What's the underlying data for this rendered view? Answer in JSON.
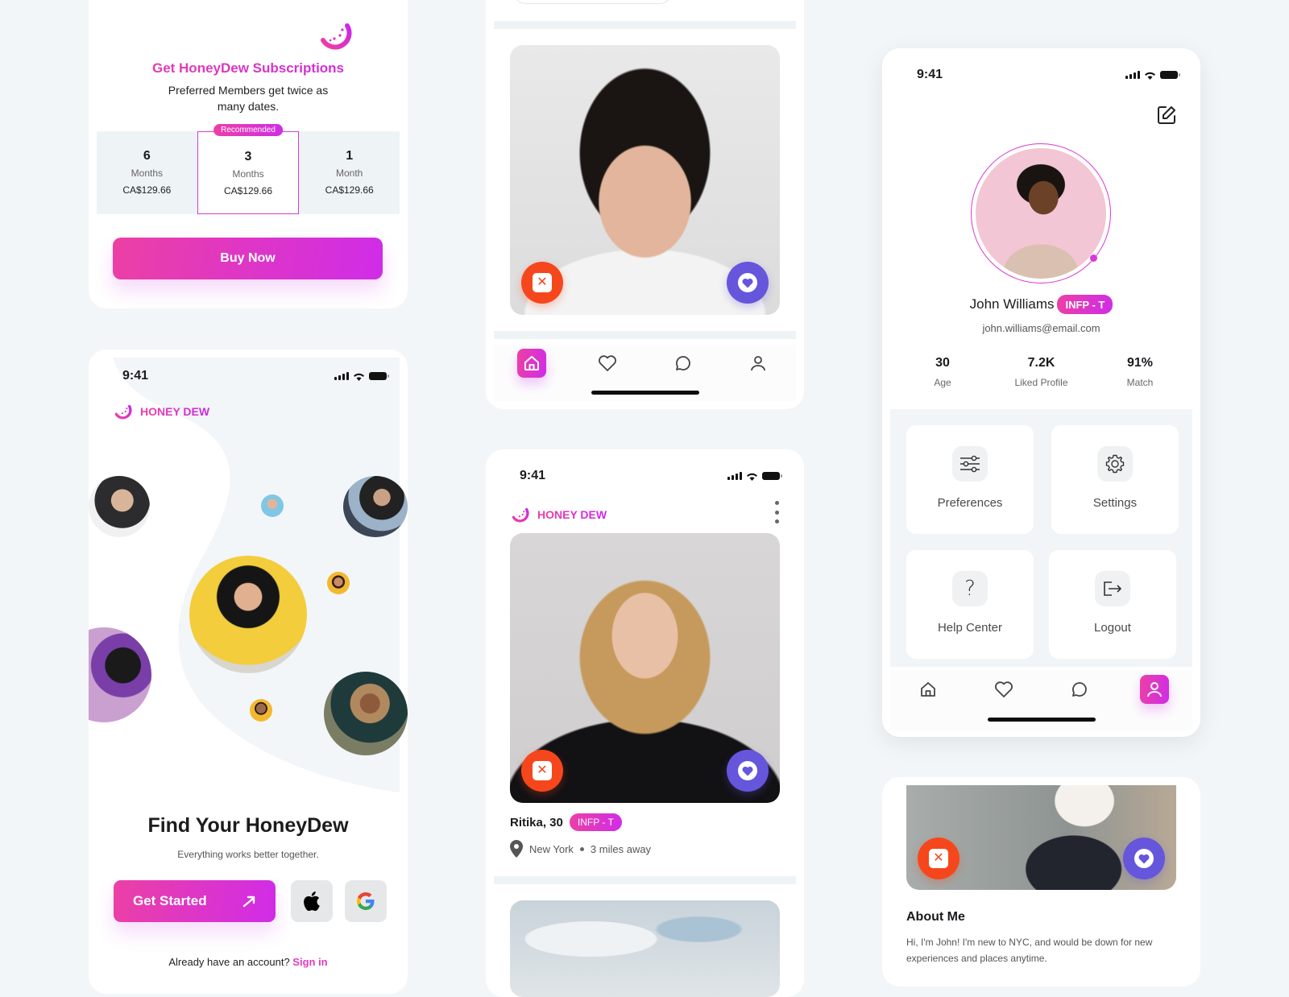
{
  "brand": {
    "name": "HONEY DEW",
    "primary_gradient_start": "#ef3fa2",
    "primary_gradient_end": "#c927ea",
    "reject_color": "#f6471c",
    "like_color": "#6556dc",
    "background": "#f2f6f9"
  },
  "status_bar": {
    "time": "9:41"
  },
  "subscription": {
    "title": "Get HoneyDew Subscriptions",
    "subtitle": "Preferred Members get twice as many dates.",
    "recommended_badge": "Recommended",
    "plans": [
      {
        "count": "6",
        "unit": "Months",
        "price": "CA$129.66",
        "selected": false
      },
      {
        "count": "3",
        "unit": "Months",
        "price": "CA$129.66",
        "selected": true
      },
      {
        "count": "1",
        "unit": "Month",
        "price": "CA$129.66",
        "selected": false
      }
    ],
    "buy_label": "Buy Now"
  },
  "onboarding": {
    "headline": "Find Your HoneyDew",
    "tagline": "Everything works better together.",
    "get_started_label": "Get Started",
    "apple_label": "Sign in with Apple",
    "google_label": "Sign in with Google",
    "signin_prompt": "Already have an account?",
    "signin_link": "Sign in"
  },
  "feed": {
    "profile": {
      "name_age": "Ritika, 30",
      "personality": "INFP - T",
      "location": "New York",
      "distance": "3 miles away"
    }
  },
  "nav": {
    "items": [
      {
        "id": "home",
        "label": "Home"
      },
      {
        "id": "likes",
        "label": "Likes"
      },
      {
        "id": "chat",
        "label": "Chat"
      },
      {
        "id": "profile",
        "label": "Profile"
      }
    ]
  },
  "account": {
    "name": "John Williams",
    "personality": "INFP - T",
    "email": "john.williams@email.com",
    "stats": [
      {
        "value": "30",
        "label": "Age"
      },
      {
        "value": "7.2K",
        "label": "Liked Profile"
      },
      {
        "value": "91%",
        "label": "Match"
      }
    ],
    "menu": [
      {
        "id": "preferences",
        "label": "Preferences"
      },
      {
        "id": "settings",
        "label": "Settings"
      },
      {
        "id": "help",
        "label": "Help Center"
      },
      {
        "id": "logout",
        "label": "Logout"
      }
    ]
  },
  "about": {
    "title": "About Me",
    "text": "Hi, I'm John! I'm new to NYC, and would be down for new experiences and places anytime."
  }
}
